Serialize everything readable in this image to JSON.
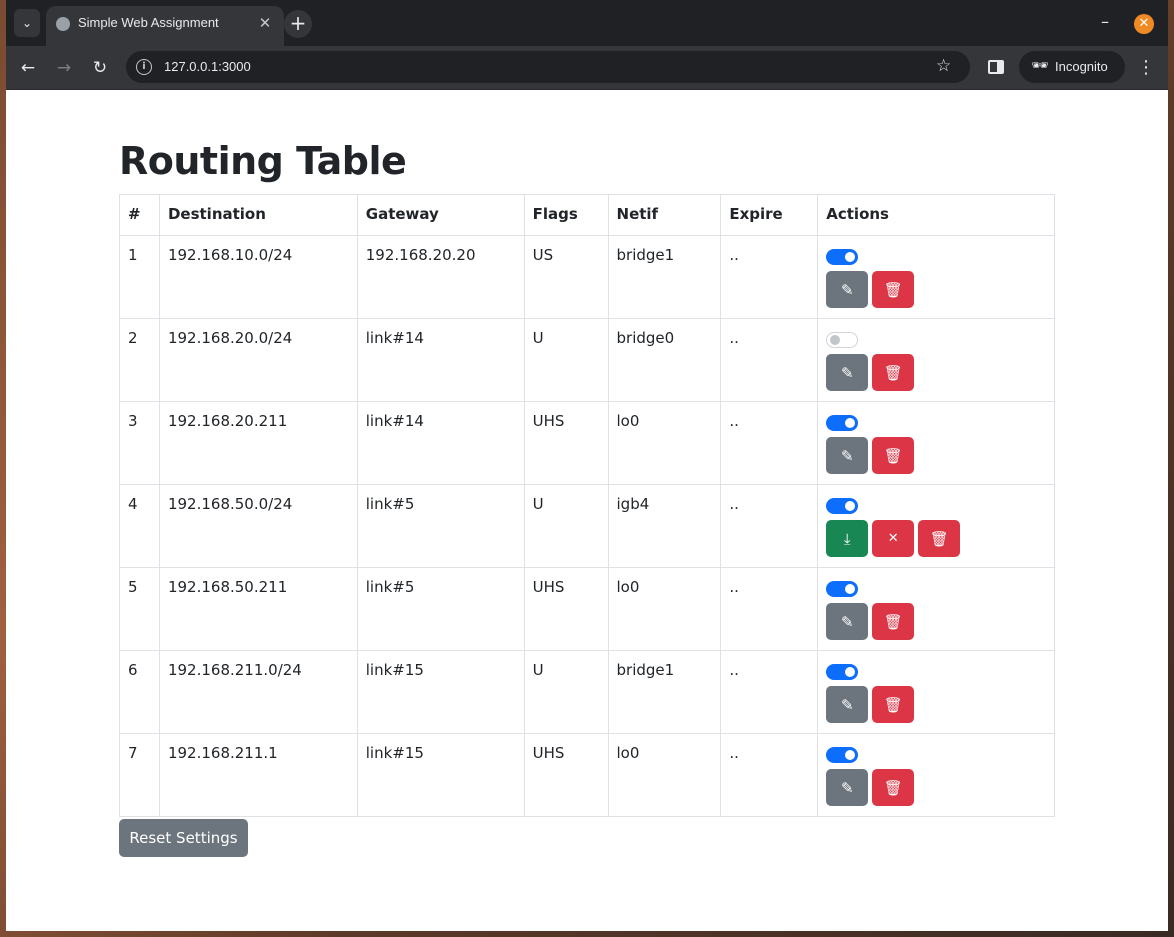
{
  "browser": {
    "tab_title": "Simple Web Assignment",
    "url": "127.0.0.1:3000",
    "incognito_label": "Incognito"
  },
  "page": {
    "title": "Routing Table",
    "reset_label": "Reset Settings"
  },
  "table": {
    "headers": [
      "#",
      "Destination",
      "Gateway",
      "Flags",
      "Netif",
      "Expire",
      "Actions"
    ],
    "rows": [
      {
        "num": "1",
        "destination": "192.168.10.0/24",
        "gateway": "192.168.20.20",
        "flags": "US",
        "netif": "bridge1",
        "expire": "..",
        "enabled": true,
        "editing": false
      },
      {
        "num": "2",
        "destination": "192.168.20.0/24",
        "gateway": "link#14",
        "flags": "U",
        "netif": "bridge0",
        "expire": "..",
        "enabled": false,
        "editing": false
      },
      {
        "num": "3",
        "destination": "192.168.20.211",
        "gateway": "link#14",
        "flags": "UHS",
        "netif": "lo0",
        "expire": "..",
        "enabled": true,
        "editing": false
      },
      {
        "num": "4",
        "destination": "192.168.50.0/24",
        "gateway": "link#5",
        "flags": "U",
        "netif": "igb4",
        "expire": "..",
        "enabled": true,
        "editing": true
      },
      {
        "num": "5",
        "destination": "192.168.50.211",
        "gateway": "link#5",
        "flags": "UHS",
        "netif": "lo0",
        "expire": "..",
        "enabled": true,
        "editing": false
      },
      {
        "num": "6",
        "destination": "192.168.211.0/24",
        "gateway": "link#15",
        "flags": "U",
        "netif": "bridge1",
        "expire": "..",
        "enabled": true,
        "editing": false
      },
      {
        "num": "7",
        "destination": "192.168.211.1",
        "gateway": "link#15",
        "flags": "UHS",
        "netif": "lo0",
        "expire": "..",
        "enabled": true,
        "editing": false
      }
    ]
  },
  "colors": {
    "switch_on": "#0d6efd",
    "edit": "#6c757d",
    "delete": "#dc3545",
    "save": "#198754"
  }
}
